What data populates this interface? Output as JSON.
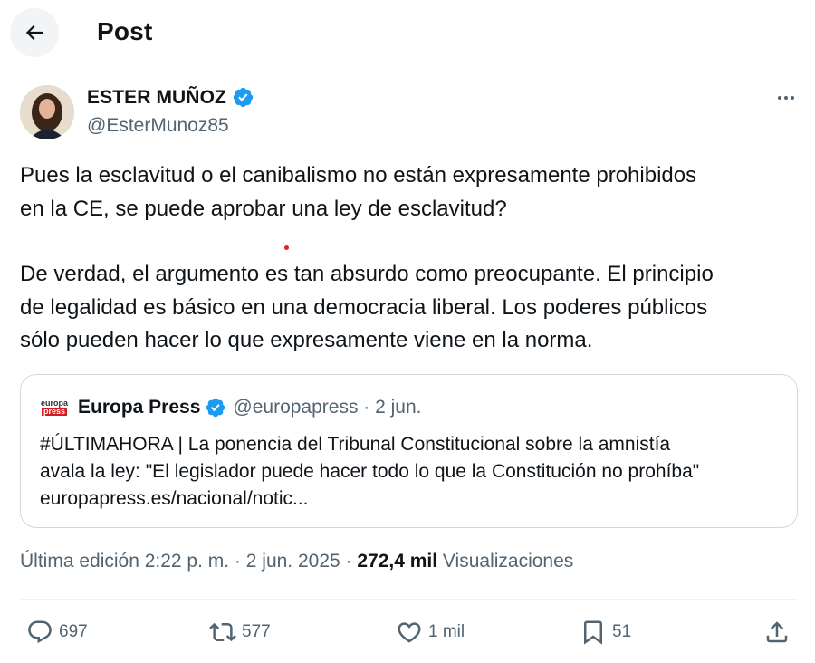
{
  "header": {
    "title": "Post"
  },
  "author": {
    "display_name": "ESTER MUÑOZ",
    "handle": "@EsterMunoz85"
  },
  "post": {
    "lines": [
      "Pues la esclavitud o el canibalismo no están expresamente prohibidos",
      "en la CE, se puede aprobar una ley de esclavitud?",
      "De verdad, el argumento es tan absurdo como preocupante. El principio",
      "de legalidad es básico en una democracia liberal. Los poderes públicos",
      "sólo pueden hacer lo que expresamente viene en la norma."
    ]
  },
  "quote": {
    "logo_line1": "europa",
    "logo_line2": "press",
    "name": "Europa Press",
    "handle_date": "@europapress · 2 jun.",
    "lines": [
      "#ÚLTIMAHORA | La ponencia del Tribunal Constitucional sobre la amnistía",
      "avala la ley: \"El legislador puede hacer todo lo que la Constitución no prohíba\"",
      "europapress.es/nacional/notic..."
    ]
  },
  "meta": {
    "edited": "Última edición 2:22 p. m. · 2 jun. 2025 · ",
    "views_count": "272,4 mil",
    "views_label": " Visualizaciones"
  },
  "actions": {
    "replies": "697",
    "reposts": "577",
    "likes": "1 mil",
    "bookmarks": "51"
  },
  "colors": {
    "text": "#0f1419",
    "secondary": "#536471",
    "verified": "#1d9bf0",
    "border": "#cfd9de"
  }
}
